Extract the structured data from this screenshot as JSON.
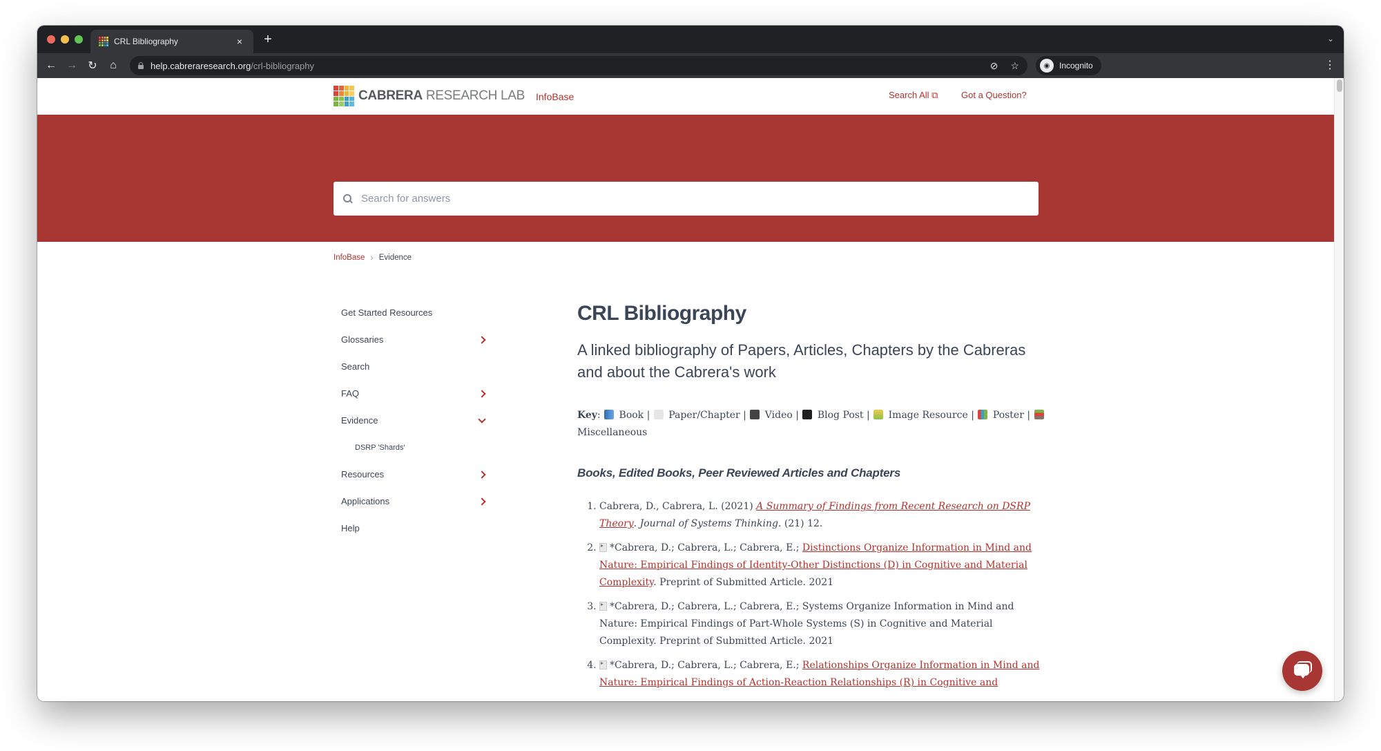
{
  "browser": {
    "tab_title": "CRL Bibliography",
    "tab_close": "×",
    "new_tab": "+",
    "url_host": "help.cabreraresearch.org",
    "url_path": "/crl-bibliography",
    "profile_label": "Incognito",
    "icons": {
      "back": "←",
      "forward": "→",
      "reload": "↻",
      "home": "⌂",
      "eye_off": "⊘",
      "star": "☆",
      "menu": "⋮",
      "tabs_dropdown": "⌄"
    }
  },
  "header": {
    "logo_bold": "CABRERA",
    "logo_light": " RESEARCH LAB",
    "nav_infobase": "InfoBase",
    "nav_search_all": "Search All ⧉",
    "nav_question": "Got a Question?",
    "brand_color": "#a83632",
    "link_color": "#b5322c"
  },
  "search": {
    "placeholder": "Search for answers",
    "value": ""
  },
  "breadcrumb": {
    "root": "InfoBase",
    "separator": "›",
    "current": "Evidence"
  },
  "sidebar": {
    "items": [
      {
        "label": "Get Started Resources",
        "chevron": "none"
      },
      {
        "label": "Glossaries",
        "chevron": "right"
      },
      {
        "label": "Search",
        "chevron": "none"
      },
      {
        "label": "FAQ",
        "chevron": "right"
      },
      {
        "label": "Evidence",
        "chevron": "down"
      },
      {
        "label": "DSRP 'Shards'",
        "chevron": "none",
        "sub": true
      },
      {
        "label": "Resources",
        "chevron": "right"
      },
      {
        "label": "Applications",
        "chevron": "right"
      },
      {
        "label": "Help",
        "chevron": "none"
      }
    ]
  },
  "main": {
    "title": "CRL Bibliography",
    "subtitle": "A linked bibliography of Papers, Articles, Chapters by the Cabreras and about the Cabrera's work",
    "key": {
      "label": "Key",
      "items": [
        {
          "icon": "book-icon",
          "label": "Book"
        },
        {
          "icon": "paper-icon",
          "label": "Paper/Chapter"
        },
        {
          "icon": "video-camera-icon",
          "label": "Video"
        },
        {
          "icon": "monitor-icon",
          "label": "Blog Post"
        },
        {
          "icon": "image-icon",
          "label": "Image Resource"
        },
        {
          "icon": "bar-chart-icon",
          "label": "Poster"
        },
        {
          "icon": "books-stack-icon",
          "label": "Miscellaneous"
        }
      ]
    },
    "section_heading": "Books, Edited Books, Peer Reviewed Articles and Chapters",
    "entries": [
      {
        "num": "1.",
        "has_paper_icon": false,
        "authors": "Cabrera, D., Cabrera, L. (2021) ",
        "link": "A Summary of Findings from Recent Research on DSRP Theory",
        "link_italic": true,
        "after_link": ". ",
        "journal": "Journal of Systems Thinking.",
        "tail": " (21) 12."
      },
      {
        "num": "2.",
        "has_paper_icon": true,
        "authors": "*Cabrera, D.; Cabrera, L.; Cabrera, E.; ",
        "link": "Distinctions Organize Information in Mind and Nature: Empirical Findings of Identity-Other Distinctions (D) in Cognitive and Material Complexity",
        "link_italic": false,
        "after_link": ". Preprint of Submitted Article. 2021",
        "journal": "",
        "tail": ""
      },
      {
        "num": "3.",
        "has_paper_icon": true,
        "authors": "*Cabrera, D.; Cabrera, L.; Cabrera, E.; Systems Organize Information in Mind and Nature: Empirical Findings of Part-Whole Systems (S) in Cognitive and Material Complexity. Preprint of Submitted Article. 2021",
        "link": "",
        "link_italic": false,
        "after_link": "",
        "journal": "",
        "tail": ""
      },
      {
        "num": "4.",
        "has_paper_icon": true,
        "authors": "*Cabrera, D.; Cabrera, L.; Cabrera, E.; ",
        "link": "Relationships Organize Information in Mind and Nature: Empirical Findings of Action-Reaction Relationships (R) in Cognitive and",
        "link_italic": false,
        "after_link": "",
        "journal": "",
        "tail": ""
      }
    ]
  },
  "chat": {
    "icon": "chat-bubble-icon"
  }
}
